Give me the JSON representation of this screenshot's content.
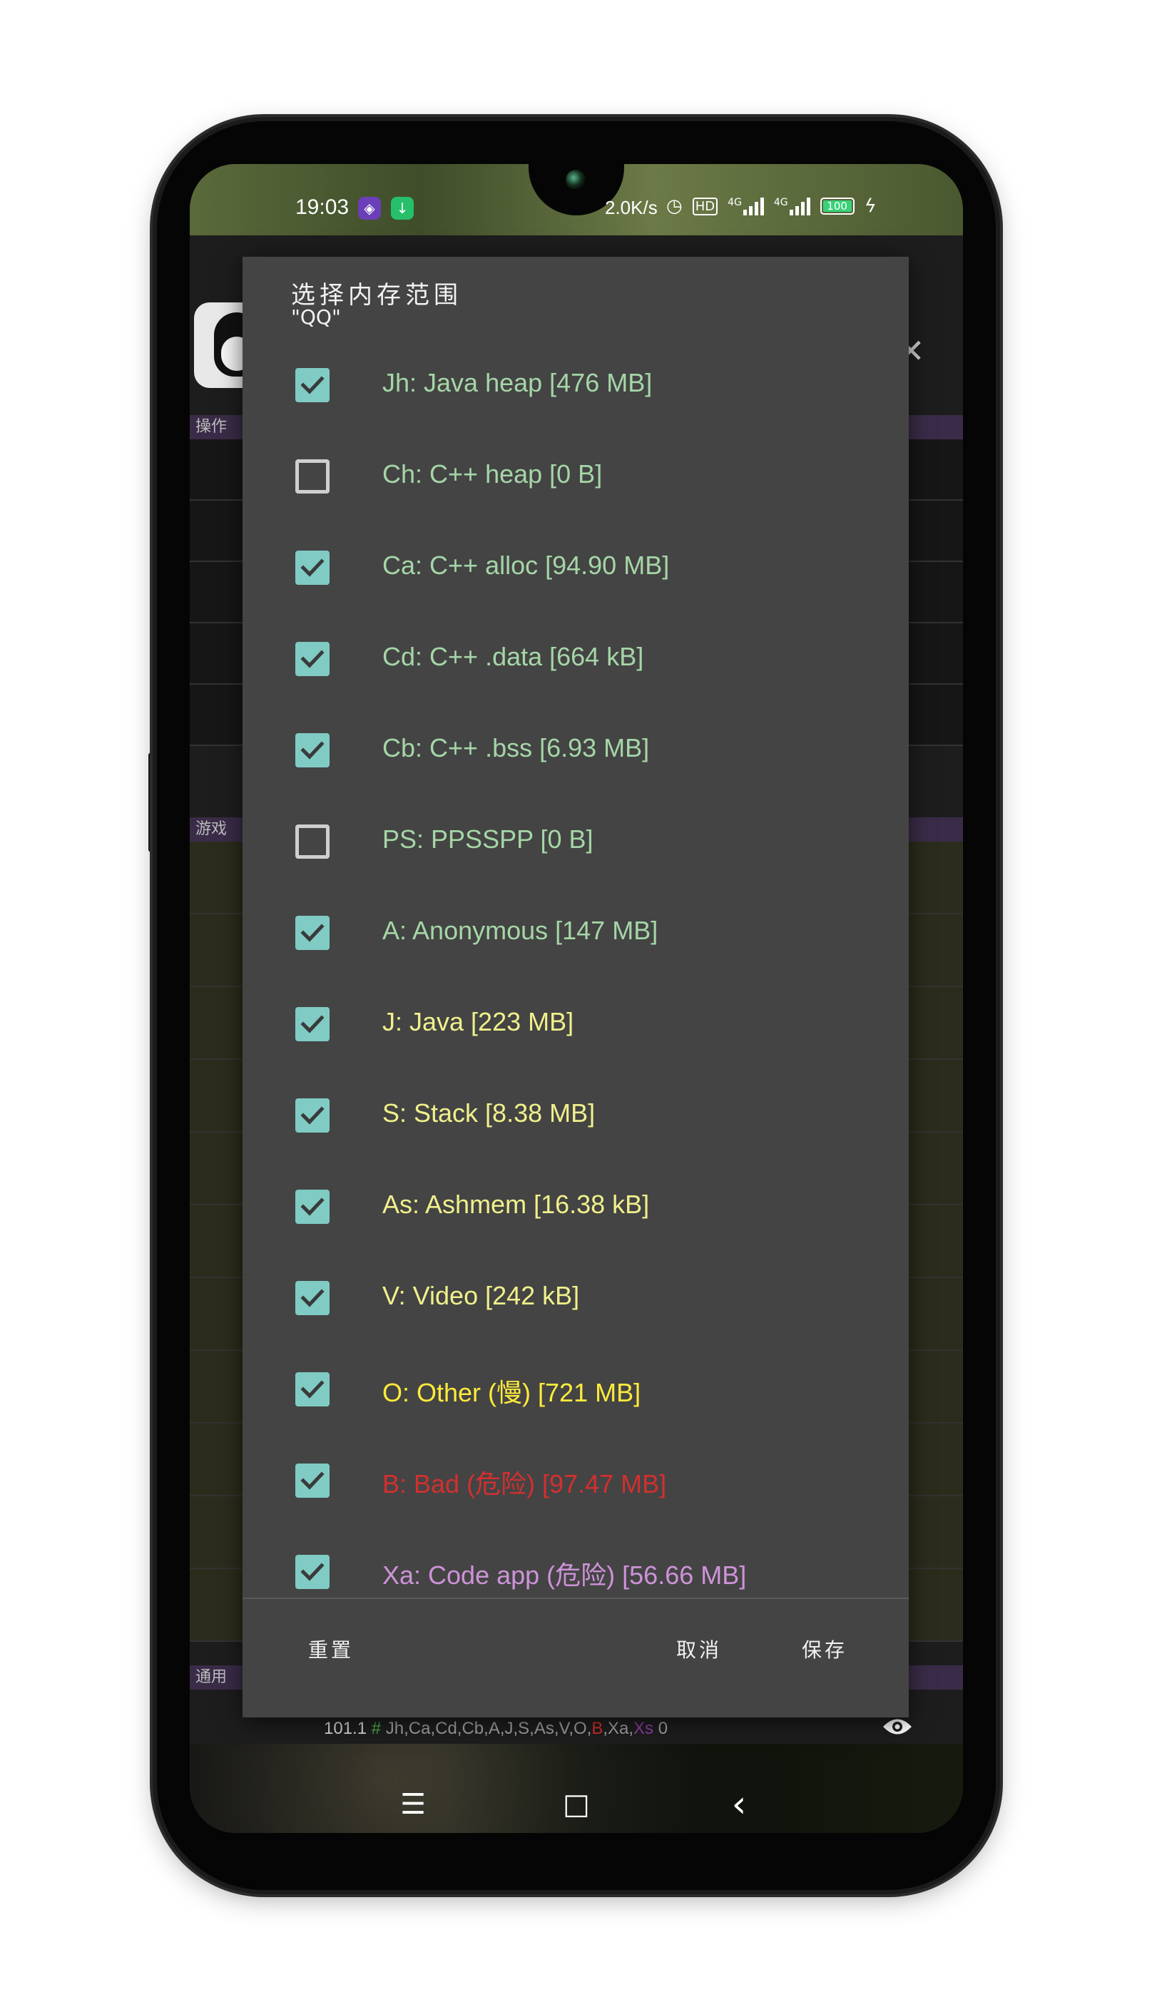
{
  "status_bar": {
    "time": "19:03",
    "net_speed": "2.0K/s",
    "hd_badge": "HD",
    "sim1": "4G",
    "sim2": "4G",
    "battery": "100"
  },
  "dialog": {
    "title": "选择内存范围",
    "subtitle": "\"QQ\"",
    "items": [
      {
        "label": "Jh: Java heap [476 MB]",
        "checked": true,
        "color": "#a5d6a7"
      },
      {
        "label": "Ch: C++ heap [0 B]",
        "checked": false,
        "color": "#a5d6a7"
      },
      {
        "label": "Ca: C++ alloc [94.90 MB]",
        "checked": true,
        "color": "#a5d6a7"
      },
      {
        "label": "Cd: C++ .data [664 kB]",
        "checked": true,
        "color": "#a5d6a7"
      },
      {
        "label": "Cb: C++ .bss [6.93 MB]",
        "checked": true,
        "color": "#a5d6a7"
      },
      {
        "label": "PS: PPSSPP [0 B]",
        "checked": false,
        "color": "#a5d6a7"
      },
      {
        "label": "A: Anonymous [147 MB]",
        "checked": true,
        "color": "#a5d6a7"
      },
      {
        "label": "J: Java [223 MB]",
        "checked": true,
        "color": "#f0f08c"
      },
      {
        "label": "S: Stack [8.38 MB]",
        "checked": true,
        "color": "#f0f08c"
      },
      {
        "label": "As: Ashmem [16.38 kB]",
        "checked": true,
        "color": "#f0f08c"
      },
      {
        "label": "V: Video [242 kB]",
        "checked": true,
        "color": "#f0f08c"
      },
      {
        "label": "O: Other (慢) [721 MB]",
        "checked": true,
        "color": "#ffeb3b"
      },
      {
        "label": "B: Bad (危险) [97.47 MB]",
        "checked": true,
        "color": "#d32f2f"
      },
      {
        "label": "Xa: Code app (危险) [56.66 MB]",
        "checked": true,
        "color": "#ce93d8"
      }
    ],
    "buttons": {
      "reset": "重置",
      "cancel": "取消",
      "save": "保存"
    }
  },
  "background_app": {
    "section_ops": "操作",
    "section_game": "游戏",
    "section_general": "通用",
    "status_line": {
      "prefix": "101.1",
      "hash": "#",
      "regions": "Jh,Ca,Cd,Cb,A,J,S,As,V,O,",
      "bad": "B",
      "sep": ",Xa,",
      "xs": "Xs",
      "suffix": " 0"
    }
  },
  "nav_bar": {
    "menu_icon": "☰",
    "home_icon": "□",
    "back_icon": "‹"
  }
}
